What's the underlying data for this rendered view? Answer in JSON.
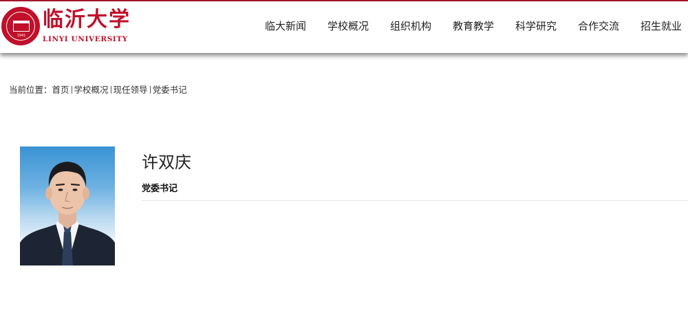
{
  "header": {
    "logo_cn": "临沂大学",
    "logo_en": "LINYI UNIVERSITY",
    "seal_year": "1941",
    "brand_color": "#c0102a"
  },
  "nav": {
    "items": [
      {
        "label": "临大新闻"
      },
      {
        "label": "学校概况"
      },
      {
        "label": "组织机构"
      },
      {
        "label": "教育教学"
      },
      {
        "label": "科学研究"
      },
      {
        "label": "合作交流"
      },
      {
        "label": "招生就业"
      }
    ]
  },
  "breadcrumb": {
    "prefix": "当前位置：",
    "items": [
      "首页",
      "学校概况",
      "现任领导",
      "党委书记"
    ]
  },
  "profile": {
    "name": "许双庆",
    "title": "党委书记",
    "photo_icon": "portrait-photo"
  }
}
